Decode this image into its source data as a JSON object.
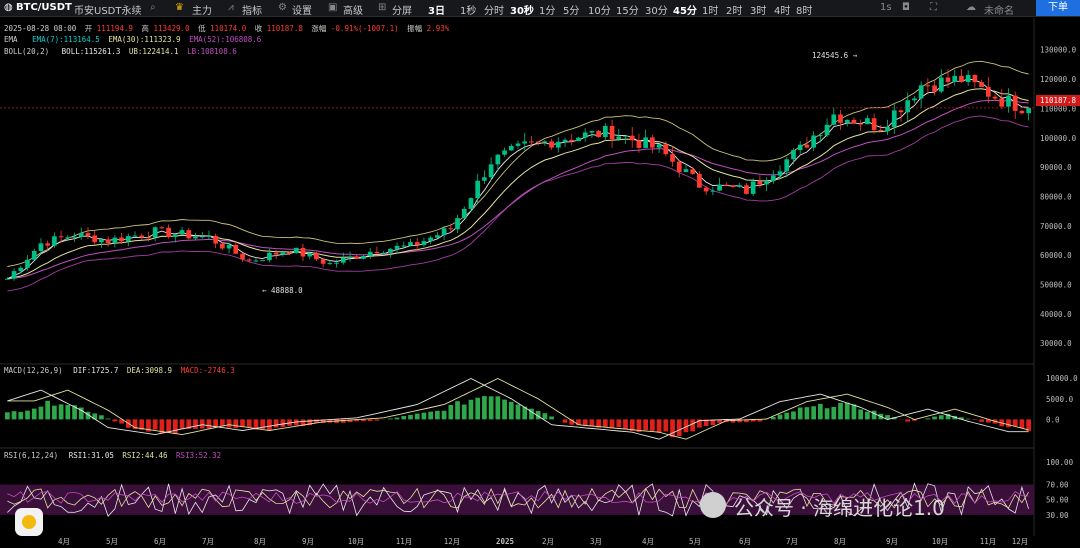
{
  "toolbar": {
    "pair": "BTC/USDT",
    "market": "币安USDT永续",
    "main": "主力",
    "indicators": "指标",
    "settings": "设置",
    "advanced": "高级",
    "split": "分屏",
    "timeframes": [
      "3日",
      "1秒",
      "分时",
      "30秒",
      "1分",
      "5分",
      "10分",
      "15分",
      "30分",
      "45分",
      "1时",
      "2时",
      "3时",
      "4时",
      "8时"
    ],
    "active_timeframes": [
      "3日",
      "30秒",
      "45分"
    ],
    "tf_1s": "1s",
    "user": "未命名",
    "signup": "下单",
    "colors": {
      "bg": "#16181c",
      "active_text": "#ffffff"
    }
  },
  "info": {
    "date": "2025-08-28 08:00",
    "open_label": "开",
    "open": "111194.9",
    "high_label": "高",
    "high": "113429.0",
    "low_label": "低",
    "low": "110174.0",
    "close_label": "收",
    "close": "110187.8",
    "change_label": "涨幅",
    "change": "-0.91%(-1007.1)",
    "amp_label": "振幅",
    "amp": "2.93%",
    "ema_label": "EMA",
    "ema7": "EMA(7):113164.5",
    "ema30": "EMA(30):111323.9",
    "ema52": "EMA(52):106808.6",
    "boll_label": "BOLL(20,2)",
    "boll": "BOLL:115261.3",
    "ub": "UB:122414.1",
    "lb": "LB:108108.6",
    "macd_label": "MACD(12,26,9)",
    "dif": "DIF:1725.7",
    "dea": "DEA:3098.9",
    "macd": "MACD:-2746.3",
    "rsi_label": "RSI(6,12,24)",
    "rsi1": "RSI1:31.05",
    "rsi2": "RSI2:44.46",
    "rsi3": "RSI3:52.32",
    "colors": {
      "up": "#00c087",
      "down": "#ff3b30",
      "ema7": "#00d0d0",
      "ema30": "#e3e3a0",
      "ema52": "#c04fc0"
    }
  },
  "annotations": {
    "high_marker": "124545.6",
    "low_marker": "48888.0"
  },
  "current_price": "110187.8",
  "watermark": "公众号 · 海绵进化论1.0",
  "chart_data": [
    {
      "type": "candlestick",
      "title": "BTC/USDT 币安USDT永续",
      "x_ticks": [
        "4月",
        "5月",
        "6月",
        "7月",
        "8月",
        "9月",
        "10月",
        "11月",
        "12月",
        "2025",
        "2月",
        "3月",
        "4月",
        "5月",
        "6月",
        "7月",
        "8月",
        "9月",
        "10月",
        "11月",
        "12月"
      ],
      "y_ticks": [
        "130000.0",
        "120000.0",
        "110000.0",
        "100000.0",
        "90000.0",
        "80000.0",
        "70000.0",
        "60000.0",
        "50000.0",
        "40000.0",
        "30000.0"
      ],
      "ylim": [
        27000,
        134000
      ],
      "last_price": 110187.8,
      "path_anchors": [
        [
          0,
          52000
        ],
        [
          5,
          64000
        ],
        [
          10,
          67000
        ],
        [
          15,
          65000
        ],
        [
          22,
          68000
        ],
        [
          30,
          66000
        ],
        [
          36,
          58000
        ],
        [
          42,
          62000
        ],
        [
          48,
          57000
        ],
        [
          55,
          62000
        ],
        [
          60,
          63000
        ],
        [
          66,
          69000
        ],
        [
          72,
          92000
        ],
        [
          77,
          97000
        ],
        [
          83,
          100000
        ],
        [
          90,
          102000
        ],
        [
          97,
          96000
        ],
        [
          103,
          84000
        ],
        [
          110,
          82000
        ],
        [
          118,
          96000
        ],
        [
          123,
          108000
        ],
        [
          130,
          104000
        ],
        [
          136,
          118000
        ],
        [
          142,
          120000
        ],
        [
          148,
          113000
        ],
        [
          152,
          110000
        ]
      ],
      "series": [
        {
          "name": "EMA(7)",
          "offset": 0
        },
        {
          "name": "EMA(30)",
          "offset": -2000
        },
        {
          "name": "EMA(52)",
          "offset": -5000
        },
        {
          "name": "BOLL",
          "offset": 0
        },
        {
          "name": "UB",
          "offset": 9000
        },
        {
          "name": "LB",
          "offset": -9000
        }
      ]
    },
    {
      "type": "bar",
      "title": "MACD(12,26,9)",
      "y_ticks": [
        "10000.0",
        "5000.0",
        "0.0"
      ],
      "ylim": [
        -5000,
        11000
      ],
      "hist_anchors": [
        [
          0,
          1500
        ],
        [
          8,
          4500
        ],
        [
          14,
          1000
        ],
        [
          18,
          -2000
        ],
        [
          25,
          -3200
        ],
        [
          32,
          -1500
        ],
        [
          38,
          -2500
        ],
        [
          46,
          -1000
        ],
        [
          55,
          -300
        ],
        [
          64,
          2000
        ],
        [
          72,
          6500
        ],
        [
          78,
          3000
        ],
        [
          84,
          -1500
        ],
        [
          96,
          -2800
        ],
        [
          100,
          -4000
        ],
        [
          106,
          -800
        ],
        [
          112,
          -500
        ],
        [
          118,
          2500
        ],
        [
          124,
          3800
        ],
        [
          130,
          1500
        ],
        [
          134,
          -600
        ],
        [
          140,
          1200
        ],
        [
          146,
          -900
        ],
        [
          152,
          -2700
        ]
      ],
      "series": [
        {
          "name": "DIF",
          "lead": 0
        },
        {
          "name": "DEA",
          "lead": 3
        }
      ]
    },
    {
      "type": "line",
      "title": "RSI(6,12,24)",
      "y_ticks": [
        "100.00",
        "70.00",
        "50.00",
        "30.00"
      ],
      "ylim": [
        10,
        105
      ],
      "band": [
        30,
        70
      ],
      "series": [
        {
          "name": "RSI1",
          "mean": 50,
          "amp": 22
        },
        {
          "name": "RSI2",
          "mean": 52,
          "amp": 13
        },
        {
          "name": "RSI3",
          "mean": 53,
          "amp": 8
        }
      ]
    }
  ]
}
